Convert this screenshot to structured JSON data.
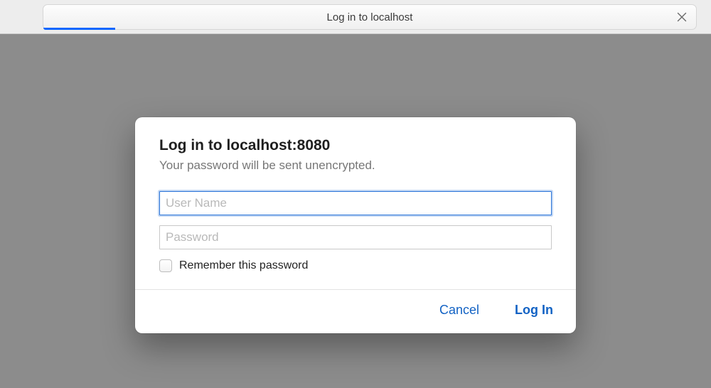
{
  "titlebar": {
    "title": "Log in to localhost"
  },
  "dialog": {
    "title": "Log in to localhost:8080",
    "subtitle": "Your password will be sent unencrypted.",
    "username": {
      "placeholder": "User Name",
      "value": ""
    },
    "password": {
      "placeholder": "Password",
      "value": ""
    },
    "remember_label": "Remember this password",
    "cancel_label": "Cancel",
    "login_label": "Log In"
  }
}
